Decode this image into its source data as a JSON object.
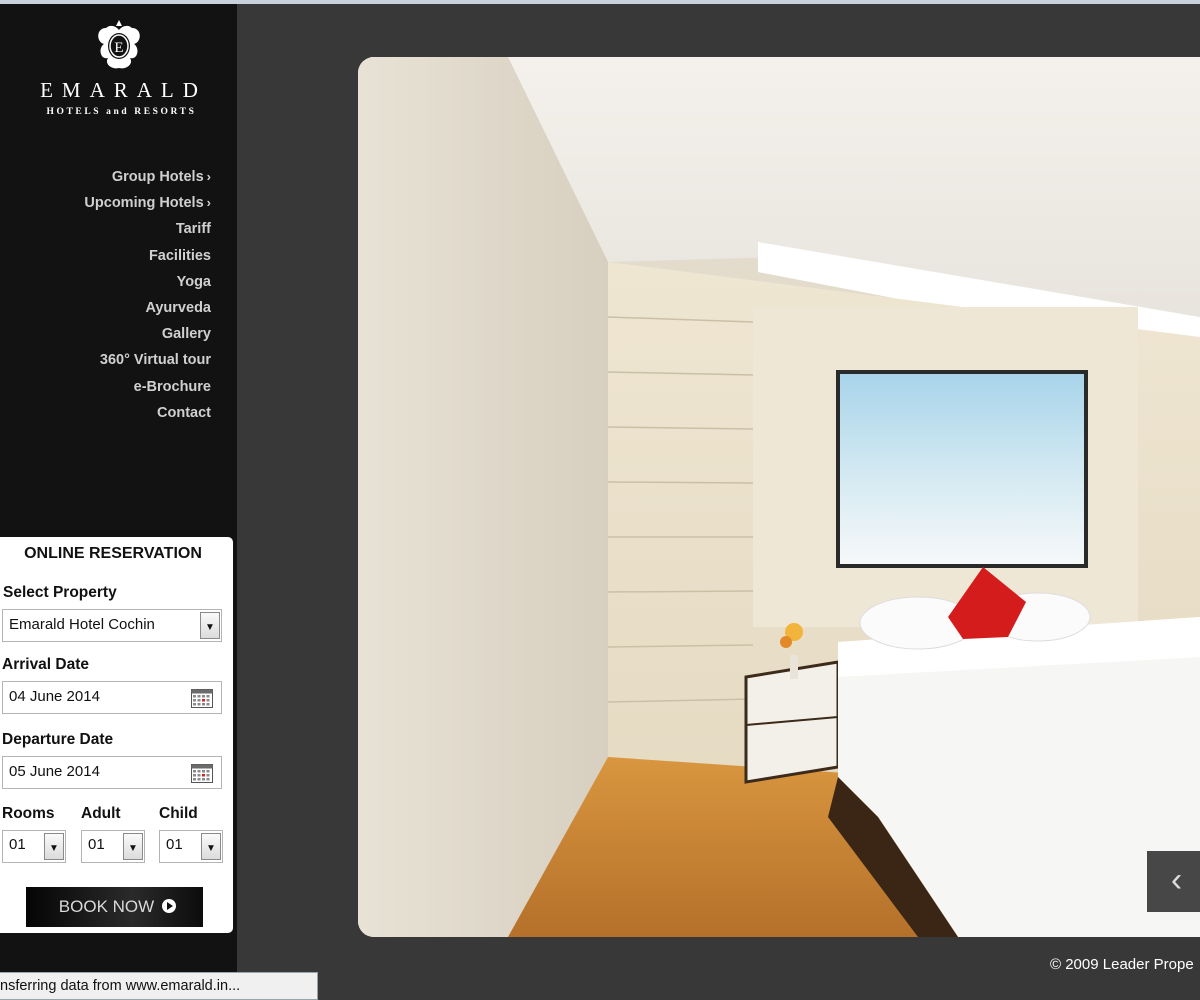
{
  "brand": {
    "name": "EMARALD",
    "tagline": "HOTELS and RESORTS"
  },
  "nav": [
    {
      "label": "Group Hotels",
      "arrow": "›"
    },
    {
      "label": "Upcoming Hotels",
      "arrow": "›"
    },
    {
      "label": "Tariff"
    },
    {
      "label": "Facilities"
    },
    {
      "label": "Yoga"
    },
    {
      "label": "Ayurveda"
    },
    {
      "label": "Gallery"
    },
    {
      "label": "360° Virtual tour"
    },
    {
      "label": "e-Brochure"
    },
    {
      "label": "Contact"
    }
  ],
  "reservation": {
    "title": "ONLINE RESERVATION",
    "property_label": "Select Property",
    "property_value": "Emarald Hotel Cochin",
    "arrival_label": "Arrival Date",
    "arrival_value": "04 June 2014",
    "departure_label": "Departure Date",
    "departure_value": "05 June 2014",
    "rooms_label": "Rooms",
    "rooms_value": "01",
    "adult_label": "Adult",
    "adult_value": "01",
    "child_label": "Child",
    "child_value": "01",
    "book_label": "BOOK NOW"
  },
  "viewer": {
    "prev_glyph": "‹"
  },
  "footer": {
    "copyright": "© 2009 Leader Prope"
  },
  "status_bar": {
    "text": "nsferring data from www.emarald.in..."
  },
  "icons": {
    "logo": "emarald-crest-icon",
    "dropdown": "chevron-down-icon",
    "calendar": "calendar-icon",
    "book": "play-circle-icon",
    "prev": "chevron-left-icon"
  },
  "colors": {
    "sidebar": "#121212",
    "page": "#383838",
    "nav_text": "#d0d0d0",
    "button": "#111111"
  }
}
